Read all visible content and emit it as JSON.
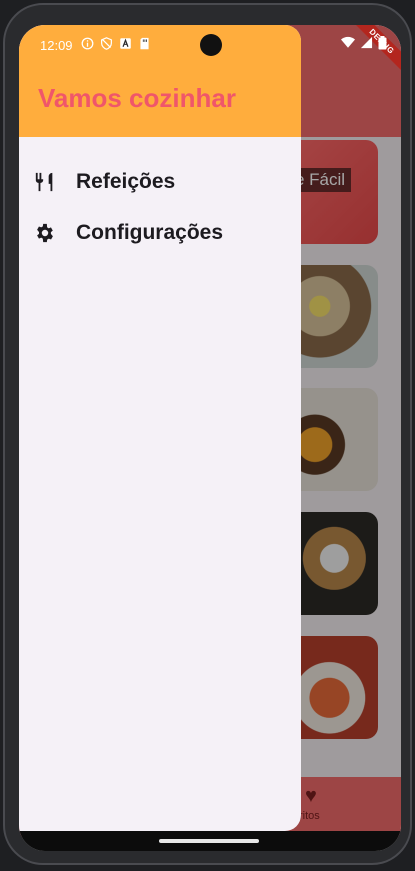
{
  "status_bar": {
    "time": "12:09"
  },
  "drawer": {
    "title": "Vamos cozinhar",
    "items": [
      {
        "label": "Refeições",
        "icon": "restaurant-icon"
      },
      {
        "label": "Configurações",
        "icon": "settings-icon"
      }
    ]
  },
  "background": {
    "category_label": "e Fácil",
    "bottom_nav_label": "ritos"
  },
  "debug_banner": "DEBUG",
  "colors": {
    "drawer_header": "#ffad3d",
    "drawer_title": "#f0566a",
    "app_bar": "#f26a6a",
    "drawer_bg": "#f5f1f7"
  }
}
